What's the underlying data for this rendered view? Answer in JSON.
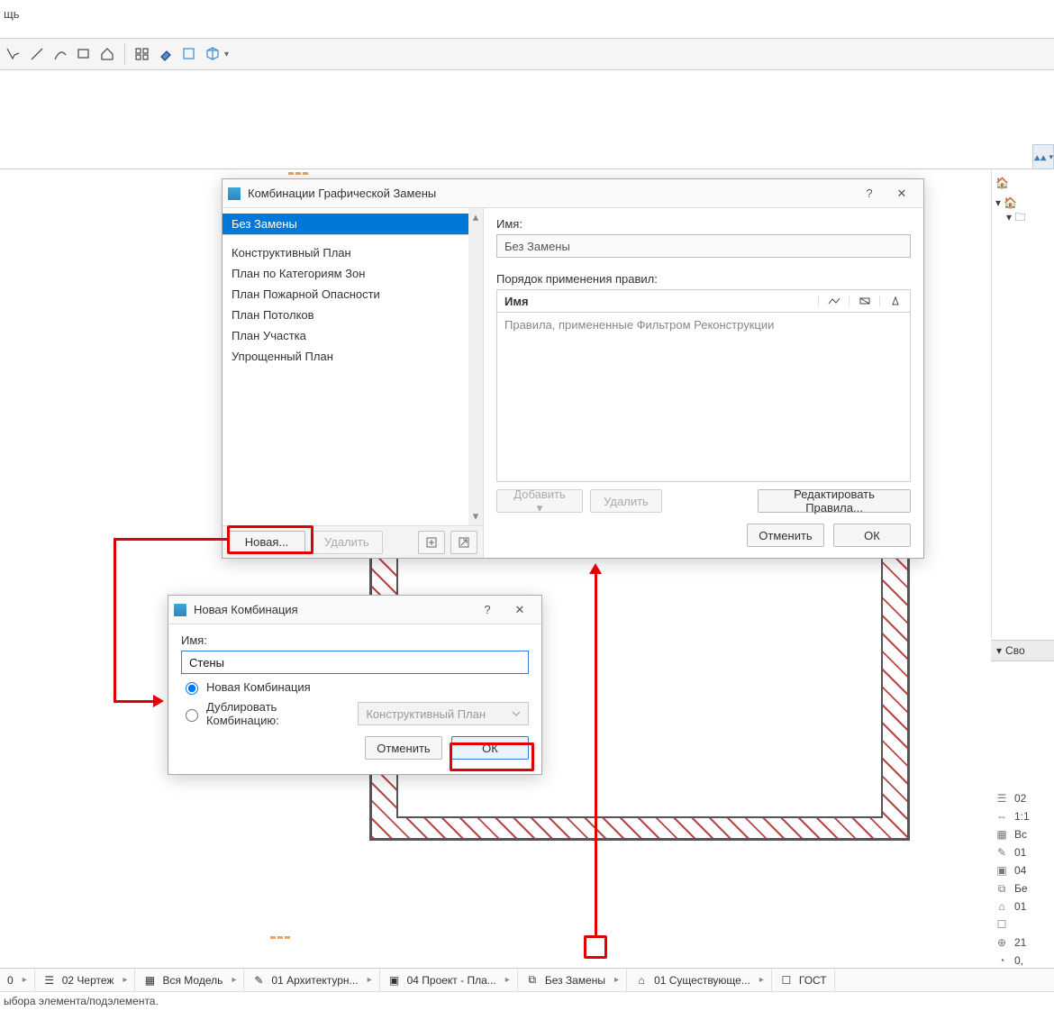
{
  "menu": {
    "help": "щь"
  },
  "dialog1": {
    "title": "Комбинации Графической Замены",
    "list": [
      "Без Замены",
      "Конструктивный План",
      "План по Категориям Зон",
      "План Пожарной Опасности",
      "План Потолков",
      "План Участка",
      "Упрощенный План"
    ],
    "name_label": "Имя:",
    "name_value": "Без Замены",
    "rules_label": "Порядок применения правил:",
    "rules_col": "Имя",
    "rules_placeholder": "Правила, примененные Фильтром Реконструкции",
    "btn_add": "Добавить ▾",
    "btn_delete_rule": "Удалить",
    "btn_edit_rules": "Редактировать Правила...",
    "btn_new": "Новая...",
    "btn_delete": "Удалить",
    "btn_cancel": "Отменить",
    "btn_ok": "ОК"
  },
  "dialog2": {
    "title": "Новая Комбинация",
    "name_label": "Имя:",
    "name_value": "Стены",
    "radio_new": "Новая Комбинация",
    "radio_dup": "Дублировать Комбинацию:",
    "dup_value": "Конструктивный План",
    "btn_cancel": "Отменить",
    "btn_ok": "ОК"
  },
  "props": {
    "header": "Сво",
    "rows": [
      {
        "icon": "layers",
        "val": "02"
      },
      {
        "icon": "scale",
        "val": "1:1"
      },
      {
        "icon": "grid",
        "val": "Вс"
      },
      {
        "icon": "pen",
        "val": "01"
      },
      {
        "icon": "window",
        "val": "04"
      },
      {
        "icon": "override",
        "val": "Бе"
      },
      {
        "icon": "reno",
        "val": "01"
      },
      {
        "icon": "dim",
        "val": " "
      },
      {
        "icon": "zoom",
        "val": "21"
      },
      {
        "icon": "angle",
        "val": "0,"
      }
    ]
  },
  "statusbar": {
    "left0": "0",
    "items": [
      {
        "icon": "layers",
        "label": "02 Чертеж"
      },
      {
        "icon": "scale",
        "label": "Вся Модель"
      },
      {
        "icon": "pen",
        "label": "01 Архитектурн..."
      },
      {
        "icon": "window",
        "label": "04 Проект - Пла..."
      },
      {
        "icon": "override",
        "label": "Без Замены"
      },
      {
        "icon": "reno",
        "label": "01 Существующе..."
      },
      {
        "icon": "dim",
        "label": "ГОСТ"
      }
    ],
    "hint": "ыбора элемента/подэлемента."
  }
}
